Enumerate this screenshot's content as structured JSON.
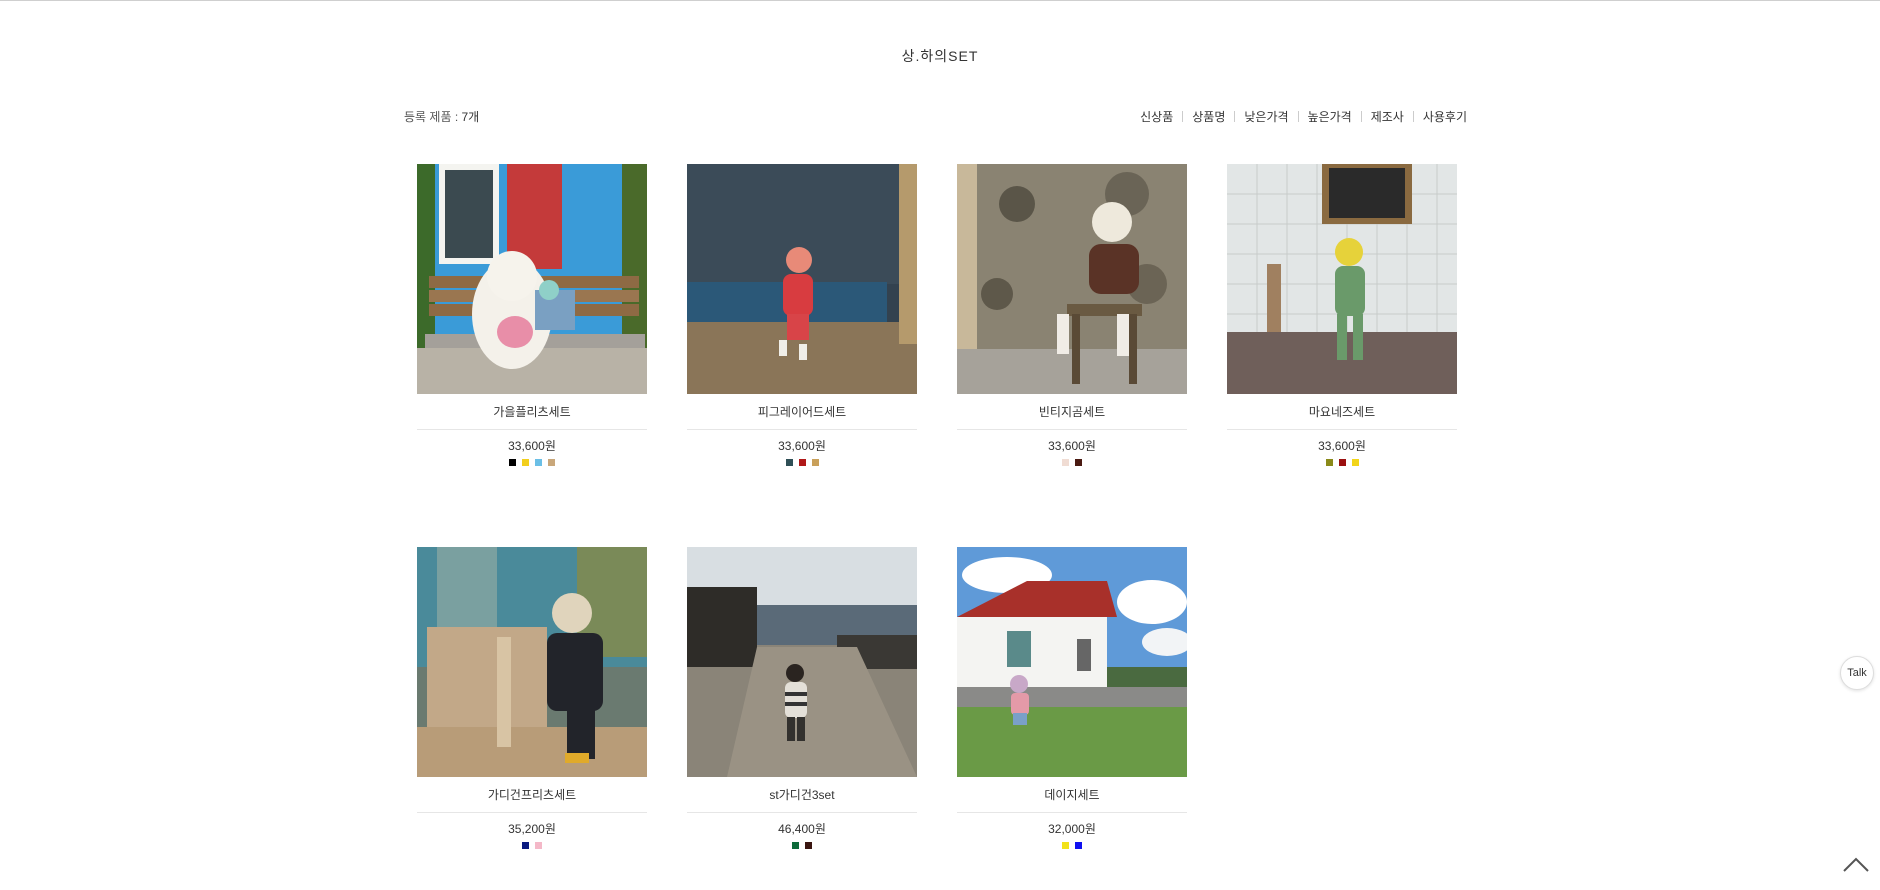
{
  "page": {
    "title": "상.하의SET"
  },
  "listing": {
    "count_label": "등록 제품 : ",
    "count_value": "7개"
  },
  "sort": [
    "신상품",
    "상품명",
    "낮은가격",
    "높은가격",
    "제조사",
    "사용후기"
  ],
  "products": [
    {
      "name": "가을플리츠세트",
      "price": "33,600원",
      "colors": [
        "#000000",
        "#f2cf1d",
        "#6bbfe6",
        "#c9a77a"
      ]
    },
    {
      "name": "피그레이어드세트",
      "price": "33,600원",
      "colors": [
        "#2f4f56",
        "#b01818",
        "#c9a05a"
      ]
    },
    {
      "name": "빈티지곰세트",
      "price": "33,600원",
      "colors": [
        "#f0dcd3",
        "#4a1a12"
      ]
    },
    {
      "name": "마요네즈세트",
      "price": "33,600원",
      "colors": [
        "#8a8a1a",
        "#9b1010",
        "#f2d51a"
      ]
    },
    {
      "name": "가디건프리츠세트",
      "price": "35,200원",
      "colors": [
        "#0a1a80",
        "#f4b8c8"
      ]
    },
    {
      "name": "st가디건3set",
      "price": "46,400원",
      "colors": [
        "#0d6b3a",
        "#3a1510"
      ]
    },
    {
      "name": "데이지세트",
      "price": "32,000원",
      "colors": [
        "#f2e21a",
        "#1010f0"
      ]
    }
  ],
  "floating": {
    "talk_label": "Talk"
  },
  "icons": {
    "scroll_top": "chevron-up-icon"
  }
}
